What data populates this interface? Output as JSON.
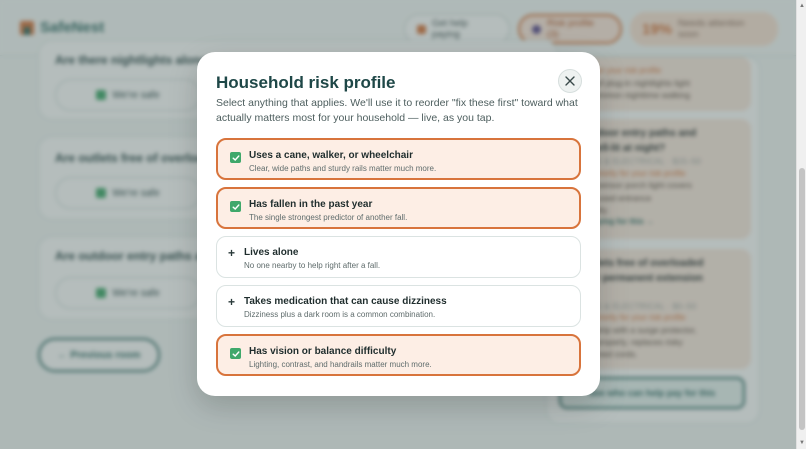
{
  "app": {
    "name": "SafeNest"
  },
  "header": {
    "help_label": "Get help paying",
    "risk_label": "Risk profile (3)",
    "attention_count": "19%",
    "attention_label": "Needs attention soon"
  },
  "questions": [
    {
      "title": "Are there nightlights along",
      "safe_label": "We're safe"
    },
    {
      "title": "Are outlets free of overloa",
      "safe_label": "We're safe"
    },
    {
      "title": "Are outdoor entry paths a",
      "safe_label": "We're safe"
    }
  ],
  "prev_button": "← Previous room",
  "side_panel": {
    "card1": {
      "title": "",
      "line1": "priority for your risk profile",
      "line2": "couple of plug-in nightlights light",
      "line3": "most common nighttime walking",
      "line4": "th."
    },
    "card2": {
      "title": "re outdoor entry paths and",
      "title2": "eps well-lit at night?",
      "cat": "GHTING & ELECTRICAL · $15–50",
      "risk": "higher priority for your risk profile",
      "body1": "motion-sensor porch light covers",
      "body2": "e most-used entrance",
      "body3": "omatically.",
      "link": "Help paying for this →"
    },
    "card3": {
      "title": "re outlets free of overloaded",
      "title2": "ugs or permanent extension",
      "title3": "ords?",
      "cat": "GHTING & ELECTRICAL · $0–50",
      "risk": "higher priority for your risk profile",
      "body1": "power strip with a surge protector,",
      "body2": "stalled properly, replaces risky",
      "body3": "isy-chained cords."
    },
    "cta": "See who can help pay for this"
  },
  "modal": {
    "title": "Household risk profile",
    "description": "Select anything that applies. We'll use it to reorder \"fix these first\" toward what actually matters most for your household — live, as you tap.",
    "options": [
      {
        "label": "Uses a cane, walker, or wheelchair",
        "sub": "Clear, wide paths and sturdy rails matter much more.",
        "selected": true
      },
      {
        "label": "Has fallen in the past year",
        "sub": "The single strongest predictor of another fall.",
        "selected": true
      },
      {
        "label": "Lives alone",
        "sub": "No one nearby to help right after a fall.",
        "selected": false
      },
      {
        "label": "Takes medication that can cause dizziness",
        "sub": "Dizziness plus a dark room is a common combination.",
        "selected": false
      },
      {
        "label": "Has vision or balance difficulty",
        "sub": "Lighting, contrast, and handrails matter much more.",
        "selected": true
      }
    ],
    "plus_glyph": "+"
  },
  "colors": {
    "accent": "#d8743c",
    "brand": "#2f6b65",
    "check": "#3fa86b"
  }
}
